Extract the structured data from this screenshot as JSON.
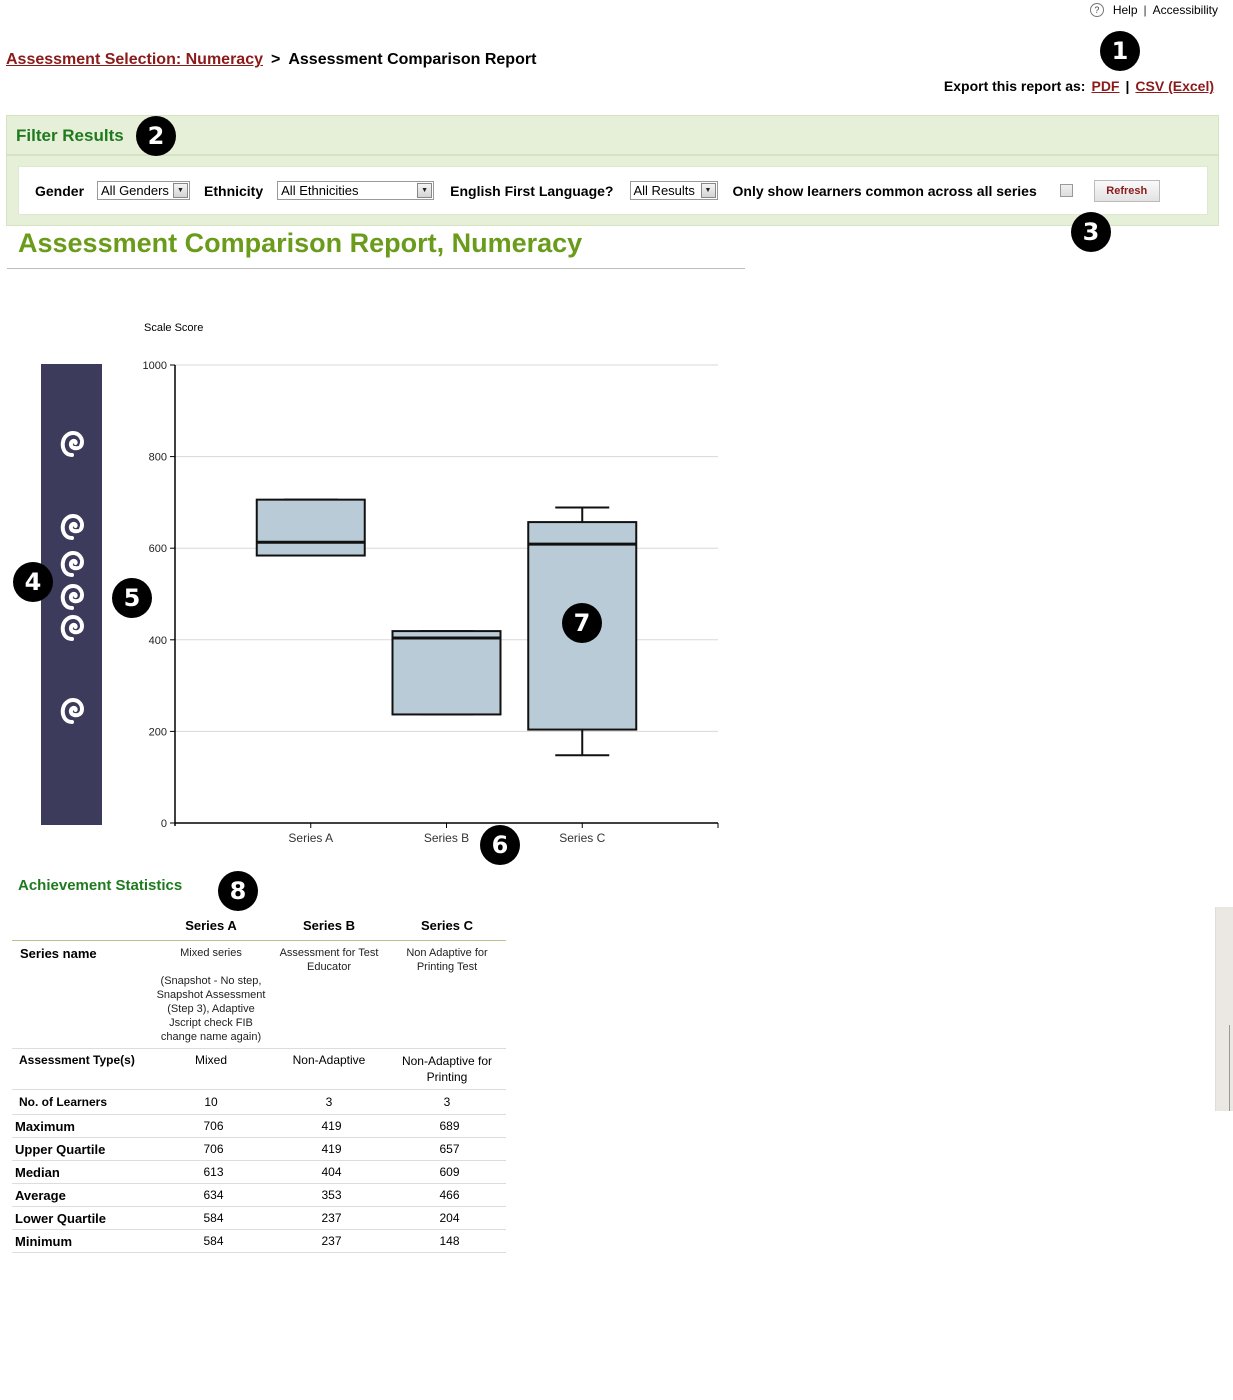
{
  "top_links": {
    "help": "Help",
    "help_icon": "?",
    "separator": "|",
    "accessibility": "Accessibility"
  },
  "breadcrumb": {
    "parent": "Assessment Selection: Numeracy",
    "separator": ">",
    "current": "Assessment Comparison Report"
  },
  "export": {
    "label": "Export this report as:",
    "pdf": "PDF",
    "separator": "|",
    "csv": "CSV (Excel)"
  },
  "markers": [
    "1",
    "2",
    "3",
    "4",
    "5",
    "6",
    "7",
    "8"
  ],
  "filter": {
    "title": "Filter Results",
    "gender_label": "Gender",
    "gender_value": "All Genders",
    "ethnicity_label": "Ethnicity",
    "ethnicity_value": "All Ethnicities",
    "english_label": "English First Language?",
    "english_value": "All Results",
    "common_label": "Only show learners common across all series",
    "common_checked": false,
    "refresh_label": "Refresh"
  },
  "report_title": "Assessment Comparison Report, Numeracy",
  "koru_legend": {
    "icons": [
      "koru-icon-level-6",
      "koru-icon-level-5",
      "koru-icon-level-4",
      "koru-icon-level-3",
      "koru-icon-level-2",
      "koru-icon-level-1"
    ],
    "color": "#3c3b5c"
  },
  "chart_data": {
    "type": "boxplot",
    "title": "",
    "ylabel": "Scale Score",
    "xlabel": "",
    "ylim": [
      0,
      1000
    ],
    "yticks": [
      0,
      200,
      400,
      600,
      800,
      1000
    ],
    "grid": true,
    "box_color": "#b9cbd6",
    "categories": [
      "Series A",
      "Series B",
      "Series C"
    ],
    "series": [
      {
        "name": "Series A",
        "min": 584,
        "q1": 584,
        "median": 613,
        "q3": 706,
        "max": 706
      },
      {
        "name": "Series B",
        "min": 237,
        "q1": 237,
        "median": 404,
        "q3": 419,
        "max": 419
      },
      {
        "name": "Series C",
        "min": 148,
        "q1": 204,
        "median": 609,
        "q3": 657,
        "max": 689
      }
    ]
  },
  "stats": {
    "title": "Achievement Statistics",
    "columns": [
      "Series A",
      "Series B",
      "Series C"
    ],
    "series_name": {
      "label": "Series name",
      "values": [
        {
          "name": "Mixed series",
          "detail": "(Snapshot - No step, Snapshot Assessment (Step 3), Adaptive Jscript check FIB change name again)"
        },
        {
          "name": "Assessment for Test Educator",
          "detail": ""
        },
        {
          "name": "Non Adaptive for Printing Test",
          "detail": ""
        }
      ]
    },
    "assessment_type": {
      "label": "Assessment Type(s)",
      "values": [
        "Mixed",
        "Non-Adaptive",
        "Non-Adaptive for Printing"
      ]
    },
    "learners": {
      "label": "No. of Learners",
      "values": [
        "10",
        "3",
        "3"
      ]
    },
    "rows": [
      {
        "label": "Maximum",
        "values": [
          "706",
          "419",
          "689"
        ]
      },
      {
        "label": "Upper Quartile",
        "values": [
          "706",
          "419",
          "657"
        ]
      },
      {
        "label": "Median",
        "values": [
          "613",
          "404",
          "609"
        ]
      },
      {
        "label": "Average",
        "values": [
          "634",
          "353",
          "466"
        ]
      },
      {
        "label": "Lower Quartile",
        "values": [
          "584",
          "237",
          "204"
        ]
      },
      {
        "label": "Minimum",
        "values": [
          "584",
          "237",
          "148"
        ]
      }
    ]
  }
}
